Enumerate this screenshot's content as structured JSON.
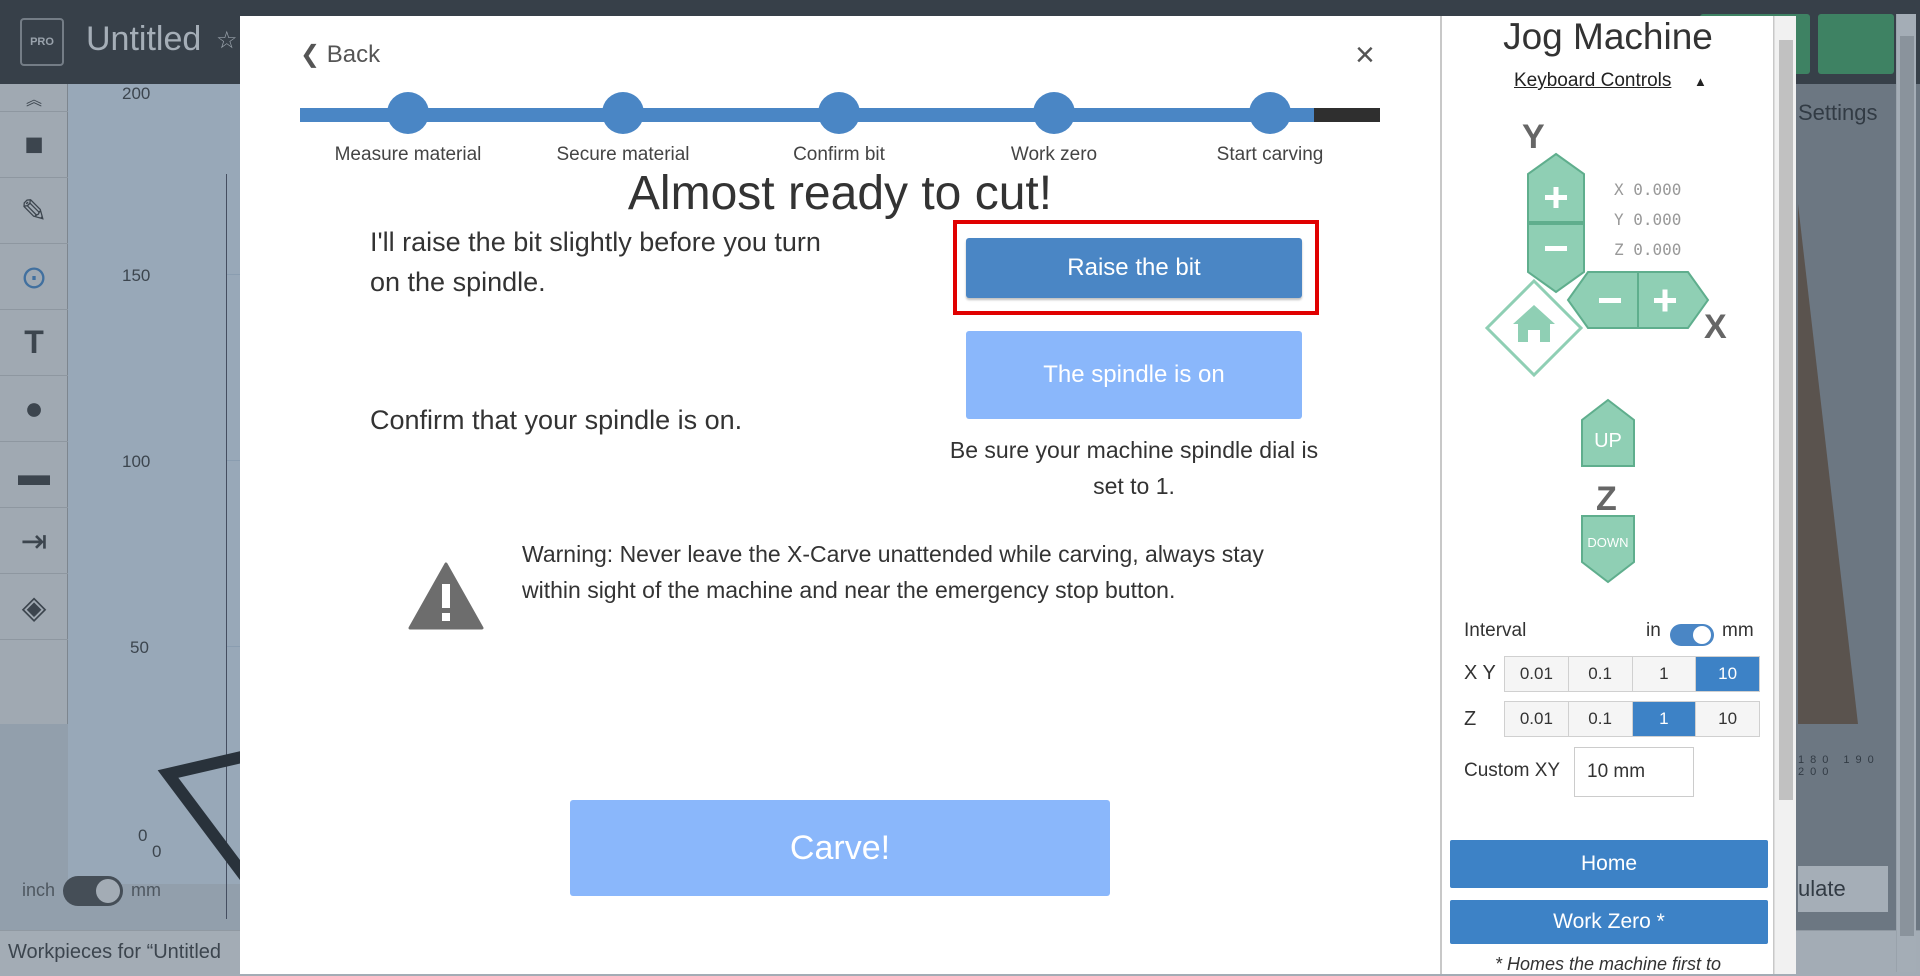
{
  "background": {
    "app_title": "Untitled",
    "logo_text": "PRO",
    "settings_label": "Settings",
    "ruler_labels": [
      "200",
      "150",
      "100",
      "50",
      "0",
      "0"
    ],
    "axis_ticks": "180 190 200",
    "unit_left": "inch",
    "unit_right": "mm",
    "workpieces_label": "Workpieces for “Untitled",
    "calc_label": "ulate"
  },
  "modal": {
    "back_label": "Back",
    "close_glyph": "×",
    "steps": [
      {
        "label": "Measure material"
      },
      {
        "label": "Secure material"
      },
      {
        "label": "Confirm bit"
      },
      {
        "label": "Work zero"
      },
      {
        "label": "Start carving"
      }
    ],
    "heading": "Almost ready to cut!",
    "raise_instruction": "I'll raise the bit slightly before you turn on the spindle.",
    "raise_button": "Raise the bit",
    "spindle_instruction": "Confirm that your spindle is on.",
    "spindle_button": "The spindle is on",
    "spindle_note": "Be sure your machine spindle dial is set to 1.",
    "warning_text": "Warning: Never leave the X-Carve unattended while carving, always stay within sight of the machine and near the emergency stop button.",
    "carve_button": "Carve!",
    "colors": {
      "primary": "#4a86c5",
      "disabled": "#8ab7fb",
      "highlight": "#e00000"
    }
  },
  "jog": {
    "title": "Jog Machine",
    "keyboard_controls": "Keyboard Controls",
    "axis_y": "Y",
    "axis_x": "X",
    "axis_z": "Z",
    "coord_x": "X 0.000",
    "coord_y": "Y 0.000",
    "coord_z": "Z 0.000",
    "up_label": "UP",
    "down_label": "DOWN",
    "interval_label": "Interval",
    "unit_in": "in",
    "unit_mm": "mm",
    "xy_label": "X Y",
    "z_label": "Z",
    "xy_options": [
      "0.01",
      "0.1",
      "1",
      "10"
    ],
    "xy_selected": "10",
    "z_options": [
      "0.01",
      "0.1",
      "1",
      "10"
    ],
    "z_selected": "1",
    "custom_xy_label": "Custom XY",
    "custom_xy_value": "10 mm",
    "home_button": "Home",
    "work_zero_button": "Work Zero *",
    "home_note": "* Homes the machine first to",
    "colors": {
      "button": "#8fcfb4",
      "button_border": "#5fae8d",
      "accent": "#3d82c6"
    }
  }
}
